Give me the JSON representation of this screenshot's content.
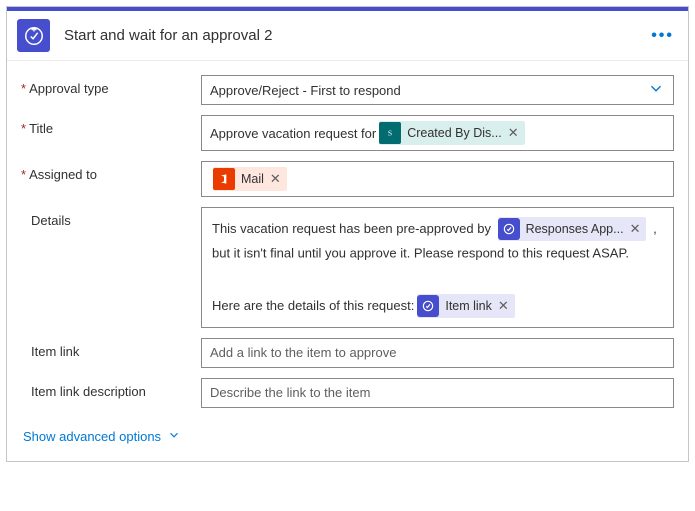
{
  "header": {
    "title": "Start and wait for an approval 2"
  },
  "labels": {
    "approval_type": "Approval type",
    "title": "Title",
    "assigned_to": "Assigned to",
    "details": "Details",
    "item_link": "Item link",
    "item_link_desc": "Item link description"
  },
  "fields": {
    "approval_type_value": "Approve/Reject - First to respond",
    "title_prefix": "Approve vacation request for",
    "title_token": "Created By Dis...",
    "assigned_token": "Mail",
    "details_text1a": "This vacation request has been pre-approved by",
    "details_token1": "Responses App...",
    "details_text1b": ",",
    "details_text1c": "but it isn't final until you approve it. Please respond to this request ASAP.",
    "details_text2": "Here are the details of this request:",
    "details_token2": "Item link",
    "item_link_placeholder": "Add a link to the item to approve",
    "item_link_desc_placeholder": "Describe the link to the item"
  },
  "footer": {
    "advanced": "Show advanced options"
  }
}
